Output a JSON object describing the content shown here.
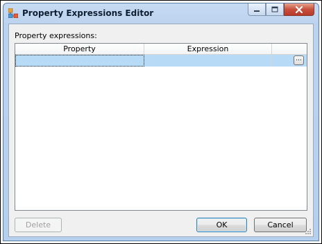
{
  "window": {
    "title": "Property Expressions Editor",
    "minimize_icon": "minimize-icon",
    "maximize_icon": "maximize-icon",
    "close_icon": "close-icon",
    "close_color": "#c8503c"
  },
  "dialog": {
    "section_label": "Property expressions:",
    "grid": {
      "columns": [
        "Property",
        "Expression"
      ],
      "rows": [
        {
          "property": "",
          "expression": "",
          "ellipsis_label": "..."
        }
      ],
      "selected_row_color": "#b7dbf6"
    },
    "buttons": {
      "delete": "Delete",
      "ok": "OK",
      "cancel": "Cancel"
    }
  }
}
